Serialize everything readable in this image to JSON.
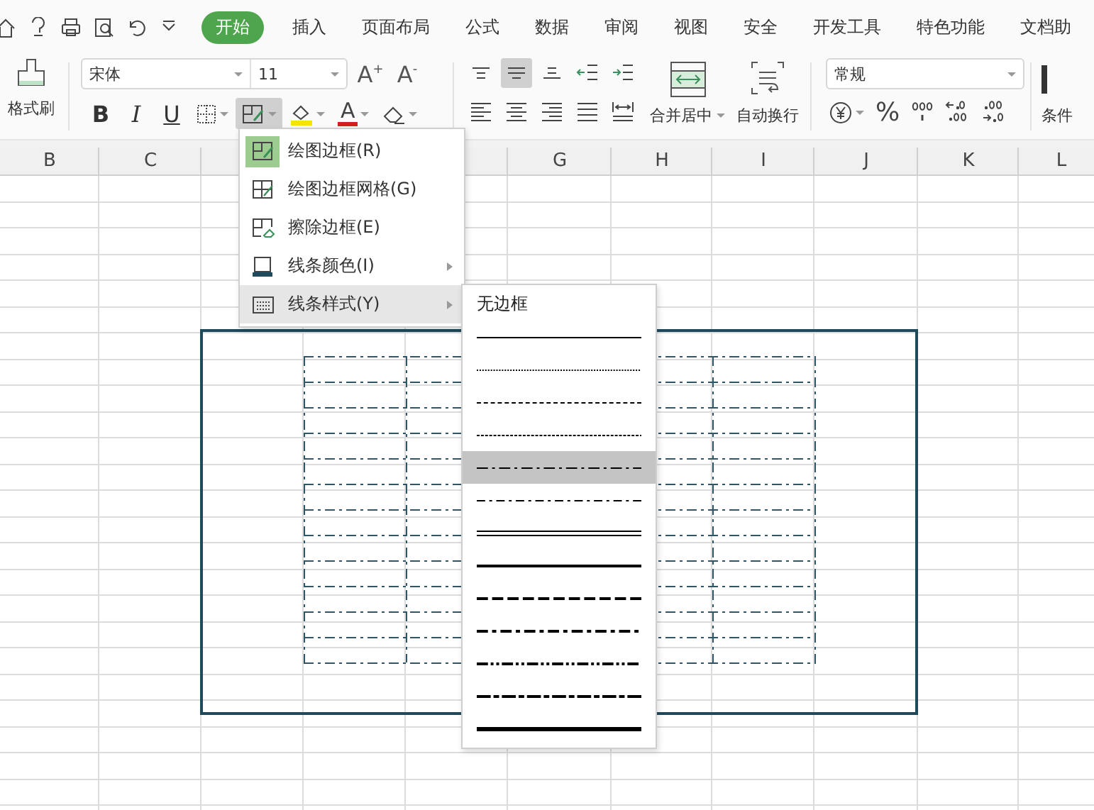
{
  "tabs": [
    {
      "label": "开始",
      "selected": true
    },
    {
      "label": "插入",
      "selected": false
    },
    {
      "label": "页面布局",
      "selected": false
    },
    {
      "label": "公式",
      "selected": false
    },
    {
      "label": "数据",
      "selected": false
    },
    {
      "label": "审阅",
      "selected": false
    },
    {
      "label": "视图",
      "selected": false
    },
    {
      "label": "安全",
      "selected": false
    },
    {
      "label": "开发工具",
      "selected": false
    },
    {
      "label": "特色功能",
      "selected": false
    },
    {
      "label": "文档助",
      "selected": false
    }
  ],
  "ribbon": {
    "format_painter": {
      "label": "格式刷"
    },
    "font": {
      "value": "宋体"
    },
    "font_size": {
      "value": "11"
    },
    "size_buttons": [
      {
        "label": "A$^{+}$"
      },
      {
        "label": "A$^{-}$"
      }
    ],
    "font_tools": [
      {
        "kind": "bold",
        "label": "B",
        "pressed": false
      },
      {
        "kind": "italic",
        "label": "I",
        "pressed": false
      },
      {
        "kind": "underline",
        "label": "U",
        "pressed": false
      },
      {
        "kind": "borders",
        "pressed": false
      },
      {
        "kind": "draw_border",
        "pressed": true
      },
      {
        "kind": "fill_color",
        "pressed": false
      },
      {
        "kind": "font_color",
        "label": "A",
        "pressed": false
      },
      {
        "kind": "clear",
        "pressed": false
      }
    ],
    "align_rows": [
      [
        {
          "kind": "top",
          "pressed": false
        },
        {
          "kind": "middle",
          "pressed": true
        },
        {
          "kind": "bottom",
          "pressed": false
        },
        {
          "kind": "outdent",
          "pressed": false
        },
        {
          "kind": "indent",
          "pressed": false
        }
      ],
      [
        {
          "kind": "left",
          "pressed": false
        },
        {
          "kind": "center",
          "pressed": false
        },
        {
          "kind": "right",
          "pressed": false
        },
        {
          "kind": "justify",
          "pressed": false
        },
        {
          "kind": "distribute",
          "pressed": false
        }
      ]
    ],
    "merge_button": {
      "label": "合并居中"
    },
    "wrap_button": {
      "label": "自动换行"
    },
    "number_format": {
      "value": "常规"
    },
    "number_tools": [
      {
        "kind": "currency"
      },
      {
        "kind": "percent",
        "label": "%"
      },
      {
        "kind": "thousands"
      },
      {
        "kind": "more_decimals"
      },
      {
        "kind": "fewer_decimals"
      }
    ],
    "conditional_button": {
      "label": "条件"
    }
  },
  "columns": [
    {
      "label": "B"
    },
    {
      "label": "C"
    },
    {},
    {},
    {},
    {
      "label": "G"
    },
    {
      "label": "H"
    },
    {
      "label": "I"
    },
    {
      "label": "J"
    },
    {
      "label": "K"
    },
    {
      "label": "L"
    }
  ],
  "border_menu": {
    "items": [
      {
        "kind": "draw_border",
        "label": "绘图边框(R)",
        "active": true,
        "selected": false,
        "has_submenu": false
      },
      {
        "kind": "draw_grid",
        "label": "绘图边框网格(G)",
        "active": false,
        "selected": false,
        "has_submenu": false
      },
      {
        "kind": "erase_border",
        "label": "擦除边框(E)",
        "active": false,
        "selected": false,
        "has_submenu": false
      },
      {
        "kind": "line_color",
        "label": "线条颜色(I)",
        "active": false,
        "selected": false,
        "has_submenu": true
      },
      {
        "kind": "line_style",
        "label": "线条样式(Y)",
        "active": false,
        "selected": true,
        "has_submenu": true
      }
    ]
  },
  "line_style_menu": {
    "items": [
      {
        "kind": "none",
        "label": "无边框",
        "selected": false
      },
      {
        "kind": "thin",
        "selected": false
      },
      {
        "kind": "dotted",
        "selected": false
      },
      {
        "kind": "dashed",
        "selected": false
      },
      {
        "kind": "hair",
        "selected": false
      },
      {
        "kind": "dash_dot",
        "selected": true
      },
      {
        "kind": "dash_dot_dot",
        "selected": false
      },
      {
        "kind": "double",
        "selected": false
      },
      {
        "kind": "medium",
        "selected": false
      },
      {
        "kind": "medium_dashed",
        "selected": false
      },
      {
        "kind": "medium_dash_dot",
        "selected": false
      },
      {
        "kind": "medium_dash_dot_dot",
        "selected": false
      },
      {
        "kind": "slant_dash_dot",
        "selected": false
      },
      {
        "kind": "thick",
        "selected": false
      }
    ]
  }
}
